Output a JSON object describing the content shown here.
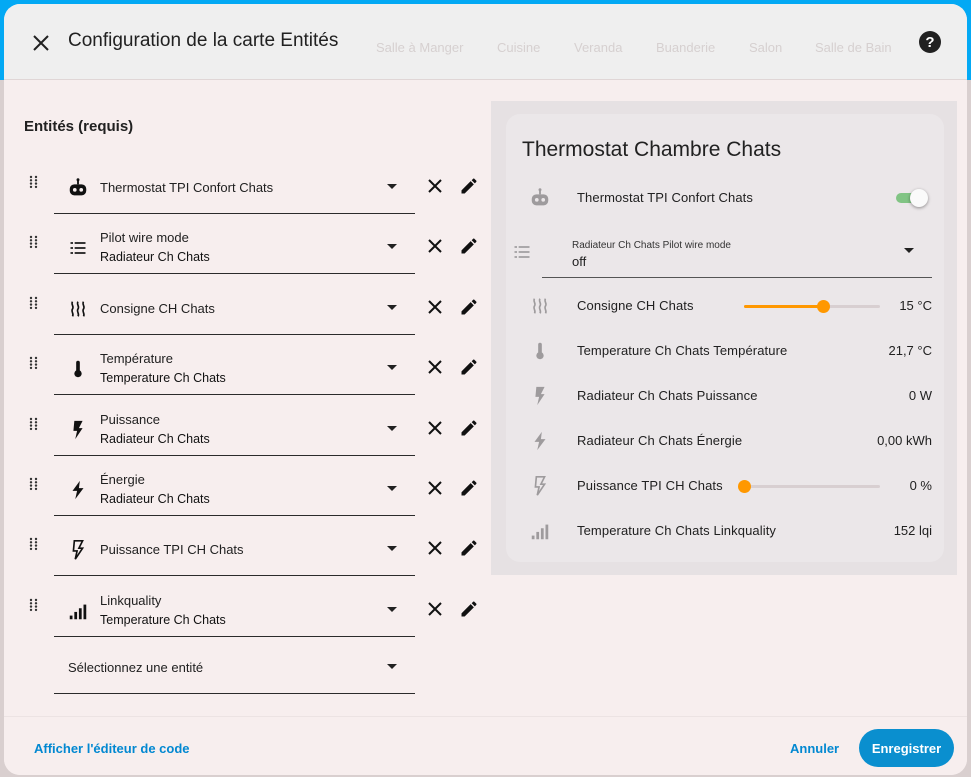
{
  "background": {
    "tabs": [
      "Salle à Manger",
      "Cuisine",
      "Veranda",
      "Buanderie",
      "Salon",
      "Salle de Bain"
    ]
  },
  "dialog": {
    "title": "Configuration de la carte Entités"
  },
  "editor": {
    "section_title": "Entités (requis)",
    "rows": [
      {
        "icon": "robot-icon",
        "name": "Thermostat TPI Confort Chats",
        "device": ""
      },
      {
        "icon": "list-icon",
        "name": "Pilot wire mode",
        "device": "Radiateur Ch Chats"
      },
      {
        "icon": "heat-wave-icon",
        "name": "Consigne CH Chats",
        "device": ""
      },
      {
        "icon": "thermometer-icon",
        "name": "Température",
        "device": "Temperature Ch Chats"
      },
      {
        "icon": "flash-icon",
        "name": "Puissance",
        "device": "Radiateur Ch Chats"
      },
      {
        "icon": "lightning-icon",
        "name": "Énergie",
        "device": "Radiateur Ch Chats"
      },
      {
        "icon": "flash-outline-icon",
        "name": "Puissance TPI CH Chats",
        "device": ""
      },
      {
        "icon": "signal-icon",
        "name": "Linkquality",
        "device": "Temperature Ch Chats"
      }
    ],
    "select_placeholder": "Sélectionnez une entité"
  },
  "preview": {
    "title": "Thermostat Chambre Chats",
    "toggle_row": {
      "name": "Thermostat TPI Confort Chats",
      "on": true
    },
    "select_row": {
      "label": "Radiateur Ch Chats Pilot wire mode",
      "value": "off"
    },
    "consigne": {
      "name": "Consigne CH Chats",
      "value": "15 °C",
      "fraction": 0.58
    },
    "temperature": {
      "name": "Temperature Ch Chats Température",
      "value": "21,7 °C"
    },
    "puissance": {
      "name": "Radiateur Ch Chats Puissance",
      "value": "0 W"
    },
    "energie": {
      "name": "Radiateur Ch Chats Énergie",
      "value": "0,00 kWh"
    },
    "tpi": {
      "name": "Puissance TPI CH Chats",
      "value": "0 %",
      "fraction": 0.0
    },
    "link": {
      "name": "Temperature Ch Chats Linkquality",
      "value": "152 lqi"
    }
  },
  "footer": {
    "code_editor": "Afficher l'éditeur de code",
    "cancel": "Annuler",
    "save": "Enregistrer"
  },
  "colors": {
    "accent": "#0288d1",
    "slider": "#ff9800",
    "toggle_on": "#66bb6a"
  }
}
